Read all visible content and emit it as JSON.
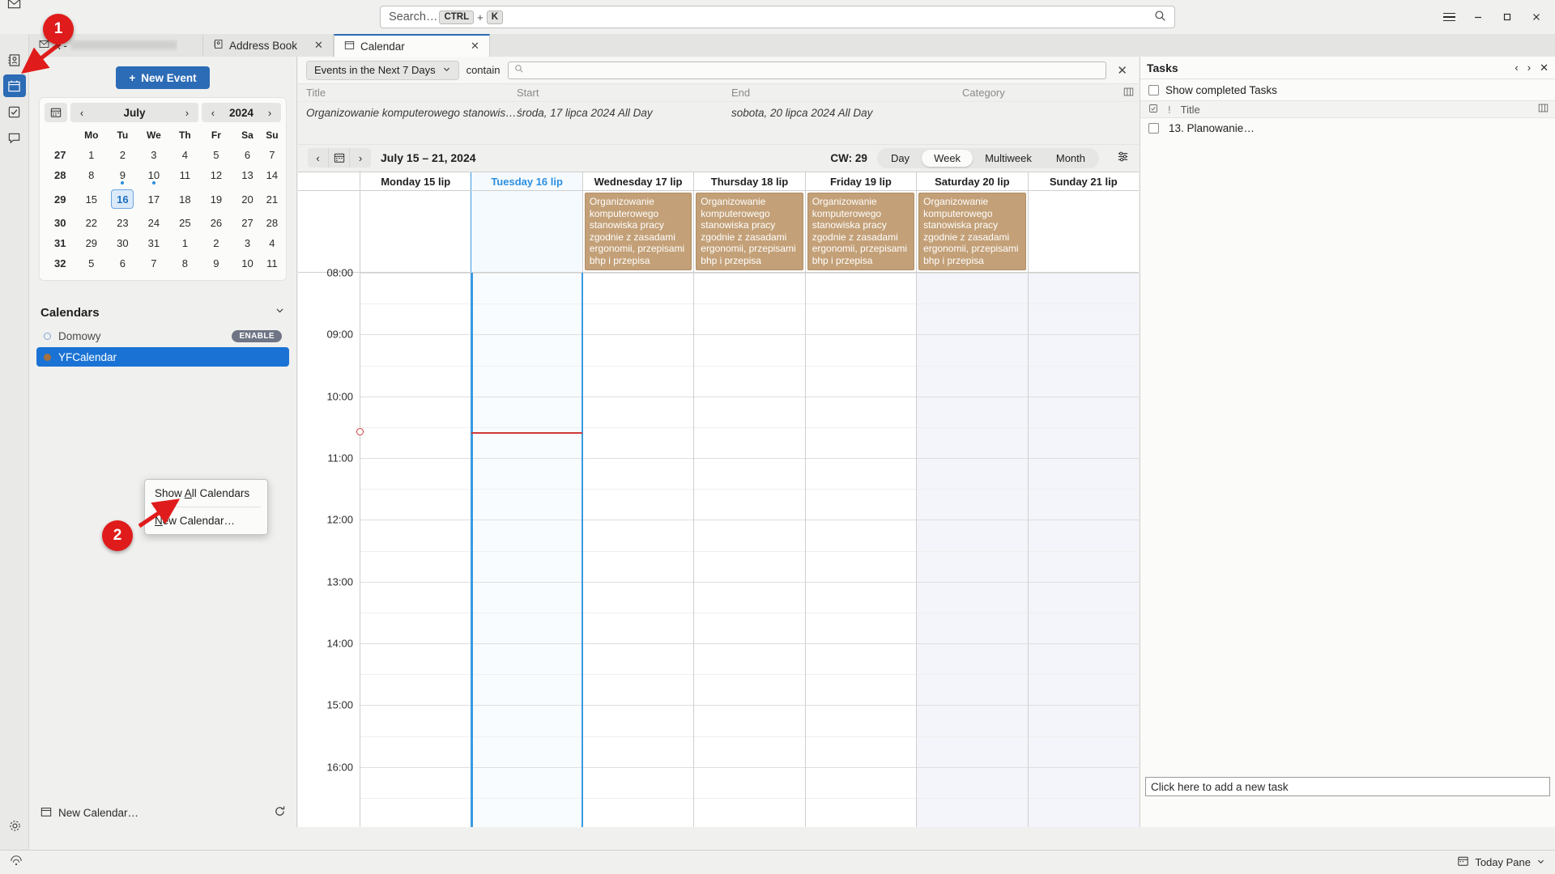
{
  "window": {
    "search_placeholder": "Search…",
    "search_kbd_ctrl": "CTRL",
    "search_kbd_plus": "+",
    "search_kbd_key": "K",
    "minimize": "—",
    "maximize": "▢",
    "close": "✕"
  },
  "tabs": [
    {
      "label": "",
      "icon": "mail-icon",
      "redacted": true,
      "closable": false
    },
    {
      "label": "Address Book",
      "icon": "address-book-icon",
      "closable": true,
      "active": false
    },
    {
      "label": "Calendar",
      "icon": "calendar-icon",
      "closable": true,
      "active": true
    }
  ],
  "sidebar": {
    "new_event_label": "New Event",
    "new_event_plus": "+",
    "minical": {
      "month": "July",
      "year": "2024",
      "prev": "‹",
      "next": "›",
      "weekday_headers": [
        "",
        "Mo",
        "Tu",
        "We",
        "Th",
        "Fr",
        "Sa",
        "Su"
      ],
      "weeks": [
        {
          "num": "27",
          "days": [
            {
              "d": "1"
            },
            {
              "d": "2"
            },
            {
              "d": "3"
            },
            {
              "d": "4"
            },
            {
              "d": "5"
            },
            {
              "d": "6"
            },
            {
              "d": "7"
            }
          ]
        },
        {
          "num": "28",
          "days": [
            {
              "d": "8"
            },
            {
              "d": "9",
              "dot": true
            },
            {
              "d": "10",
              "dot": true
            },
            {
              "d": "11"
            },
            {
              "d": "12"
            },
            {
              "d": "13"
            },
            {
              "d": "14"
            }
          ]
        },
        {
          "num": "29",
          "days": [
            {
              "d": "15"
            },
            {
              "d": "16",
              "today": true
            },
            {
              "d": "17"
            },
            {
              "d": "18"
            },
            {
              "d": "19"
            },
            {
              "d": "20"
            },
            {
              "d": "21"
            }
          ]
        },
        {
          "num": "30",
          "days": [
            {
              "d": "22"
            },
            {
              "d": "23"
            },
            {
              "d": "24"
            },
            {
              "d": "25"
            },
            {
              "d": "26"
            },
            {
              "d": "27"
            },
            {
              "d": "28"
            }
          ]
        },
        {
          "num": "31",
          "days": [
            {
              "d": "29"
            },
            {
              "d": "30"
            },
            {
              "d": "31"
            },
            {
              "d": "1",
              "other": true
            },
            {
              "d": "2",
              "other": true
            },
            {
              "d": "3",
              "other": true
            },
            {
              "d": "4",
              "other": true
            }
          ]
        },
        {
          "num": "32",
          "days": [
            {
              "d": "5",
              "other": true
            },
            {
              "d": "6",
              "other": true
            },
            {
              "d": "7",
              "other": true
            },
            {
              "d": "8",
              "other": true
            },
            {
              "d": "9",
              "other": true
            },
            {
              "d": "10",
              "other": true
            },
            {
              "d": "11",
              "other": true
            }
          ]
        }
      ]
    },
    "calendars_heading": "Calendars",
    "calendars_collapse_icon": "chevron-down-icon",
    "calendars": [
      {
        "name": "Domowy",
        "color": "#7ca8d8",
        "filled": false,
        "selected": false,
        "badge": "ENABLE"
      },
      {
        "name": "YFCalendar",
        "color": "#a6703f",
        "filled": true,
        "selected": true,
        "badge": ""
      }
    ],
    "footer_new_calendar": "New Calendar…",
    "footer_sync_icon": "sync-icon"
  },
  "context_menu": {
    "items": [
      {
        "pre": "Show ",
        "acc": "A",
        "post": "ll Calendars"
      },
      {
        "pre": "",
        "acc": "N",
        "post": "ew Calendar…"
      }
    ]
  },
  "filterbar": {
    "range_dropdown": "Events in the Next 7 Days",
    "chevron": "⌄",
    "contain_label": "contain",
    "find_placeholder": "",
    "clear_icon": "✕"
  },
  "event_list": {
    "columns": [
      "Title",
      "Start",
      "End",
      "Category"
    ],
    "column_picker_icon": "column-picker-icon",
    "rows": [
      {
        "title": "Organizowanie komputerowego stanowiska p…",
        "start": "środa, 17 lipca 2024 All Day",
        "end": "sobota, 20 lipca 2024 All Day",
        "category": ""
      }
    ]
  },
  "cal_toolbar": {
    "prev": "‹",
    "today_icon": "today-calendar-icon",
    "next": "›",
    "range": "July 15 – 21, 2024",
    "cw_label": "CW: 29",
    "views": [
      {
        "label": "Day",
        "active": false
      },
      {
        "label": "Week",
        "active": true
      },
      {
        "label": "Multiweek",
        "active": false
      },
      {
        "label": "Month",
        "active": false
      }
    ],
    "options_icon": "view-options-icon"
  },
  "week_view": {
    "days": [
      {
        "header": "Monday 15 lip",
        "today": false,
        "weekend": false,
        "allday": ""
      },
      {
        "header": "Tuesday 16 lip",
        "today": true,
        "weekend": false,
        "allday": ""
      },
      {
        "header": "Wednesday 17 lip",
        "today": false,
        "weekend": false,
        "allday": "Organizowanie komputerowego stanowiska pracy zgodnie z zasadami ergonomii, przepisami bhp i przepisa"
      },
      {
        "header": "Thursday 18 lip",
        "today": false,
        "weekend": false,
        "allday": "Organizowanie komputerowego stanowiska pracy zgodnie z zasadami ergonomii, przepisami bhp i przepisa"
      },
      {
        "header": "Friday 19 lip",
        "today": false,
        "weekend": false,
        "allday": "Organizowanie komputerowego stanowiska pracy zgodnie z zasadami ergonomii, przepisami bhp i przepisa"
      },
      {
        "header": "Saturday 20 lip",
        "today": false,
        "weekend": true,
        "allday": "Organizowanie komputerowego stanowiska pracy zgodnie z zasadami ergonomii, przepisami bhp i przepisa"
      },
      {
        "header": "Sunday 21 lip",
        "today": false,
        "weekend": true,
        "allday": ""
      }
    ],
    "hours": [
      "08:00",
      "09:00",
      "10:00",
      "11:00",
      "12:00",
      "13:00",
      "14:00",
      "15:00",
      "16:00"
    ],
    "event_color": "#c3a077",
    "now_time": "10:35"
  },
  "tasks": {
    "title": "Tasks",
    "prev": "‹",
    "next": "›",
    "close": "✕",
    "show_completed_label": "Show completed Tasks",
    "column_title": "Title",
    "column_check_icon": "checkbox-header-icon",
    "column_priority_icon": "priority-header-icon",
    "column_picker_icon": "column-picker-icon",
    "rows": [
      {
        "title": "13. Planowanie…",
        "done": false
      }
    ],
    "add_placeholder": "Click here to add a new task"
  },
  "statusbar": {
    "left_icon": "network-offline-icon",
    "today_pane_label": "Today Pane",
    "today_pane_icon": "today-pane-icon",
    "chevron": "⌄"
  },
  "annotations": [
    {
      "number": "1"
    },
    {
      "number": "2"
    }
  ]
}
